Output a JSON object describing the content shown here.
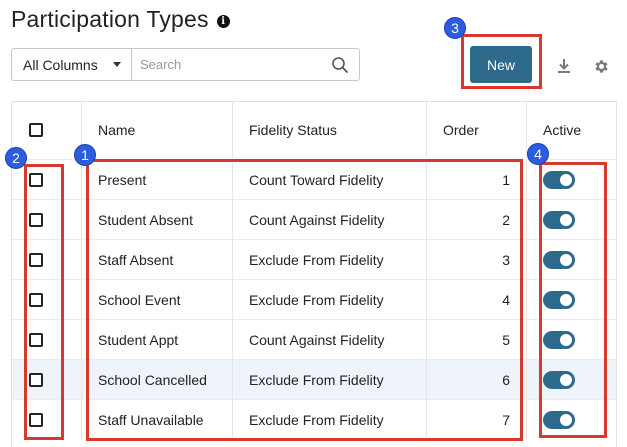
{
  "page": {
    "title": "Participation Types"
  },
  "toolbar": {
    "column_filter": "All Columns",
    "search_placeholder": "Search"
  },
  "actions": {
    "new_label": "New"
  },
  "table": {
    "headers": {
      "name": "Name",
      "fidelity_status": "Fidelity Status",
      "order": "Order",
      "active": "Active"
    },
    "rows": [
      {
        "name": "Present",
        "fidelity_status": "Count Toward Fidelity",
        "order": "1",
        "active": true
      },
      {
        "name": "Student Absent",
        "fidelity_status": "Count Against Fidelity",
        "order": "2",
        "active": true
      },
      {
        "name": "Staff Absent",
        "fidelity_status": "Exclude From Fidelity",
        "order": "3",
        "active": true
      },
      {
        "name": "School Event",
        "fidelity_status": "Exclude From Fidelity",
        "order": "4",
        "active": true
      },
      {
        "name": "Student Appt",
        "fidelity_status": "Count Against Fidelity",
        "order": "5",
        "active": true
      },
      {
        "name": "School Cancelled",
        "fidelity_status": "Exclude From Fidelity",
        "order": "6",
        "active": true
      },
      {
        "name": "Staff Unavailable",
        "fidelity_status": "Exclude From Fidelity",
        "order": "7",
        "active": true
      }
    ]
  },
  "annotations": {
    "badge_1": "1",
    "badge_2": "2",
    "badge_3": "3",
    "badge_4": "4"
  },
  "colors": {
    "accent": "#2d6a8c",
    "highlight": "#d63a2f",
    "badge": "#2c5de0",
    "row_shade": "#eef4fa"
  }
}
